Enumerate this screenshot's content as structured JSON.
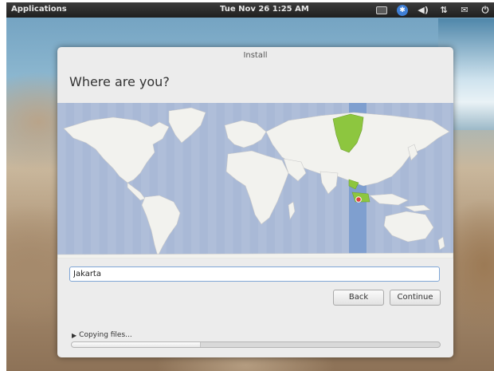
{
  "panel": {
    "applications_label": "Applications",
    "clock": "Tue Nov 26  1:25 AM",
    "tray_icons": [
      "network-icon",
      "accessibility-icon",
      "volume-icon",
      "transfer-icon",
      "mail-icon",
      "power-icon"
    ]
  },
  "window": {
    "title": "Install",
    "heading": "Where are you?"
  },
  "location": {
    "value": "Jakarta",
    "selected_timezone_offset_hours": 7
  },
  "buttons": {
    "back": "Back",
    "continue": "Continue"
  },
  "progress": {
    "label": "Copying files...",
    "fraction": 0.35
  },
  "colors": {
    "map_ocean": "#a9b9d6",
    "map_land": "#f2f2ee",
    "timezone_band": "#7f9fcf",
    "timezone_land": "#8dc63f",
    "location_marker": "#e04040"
  }
}
